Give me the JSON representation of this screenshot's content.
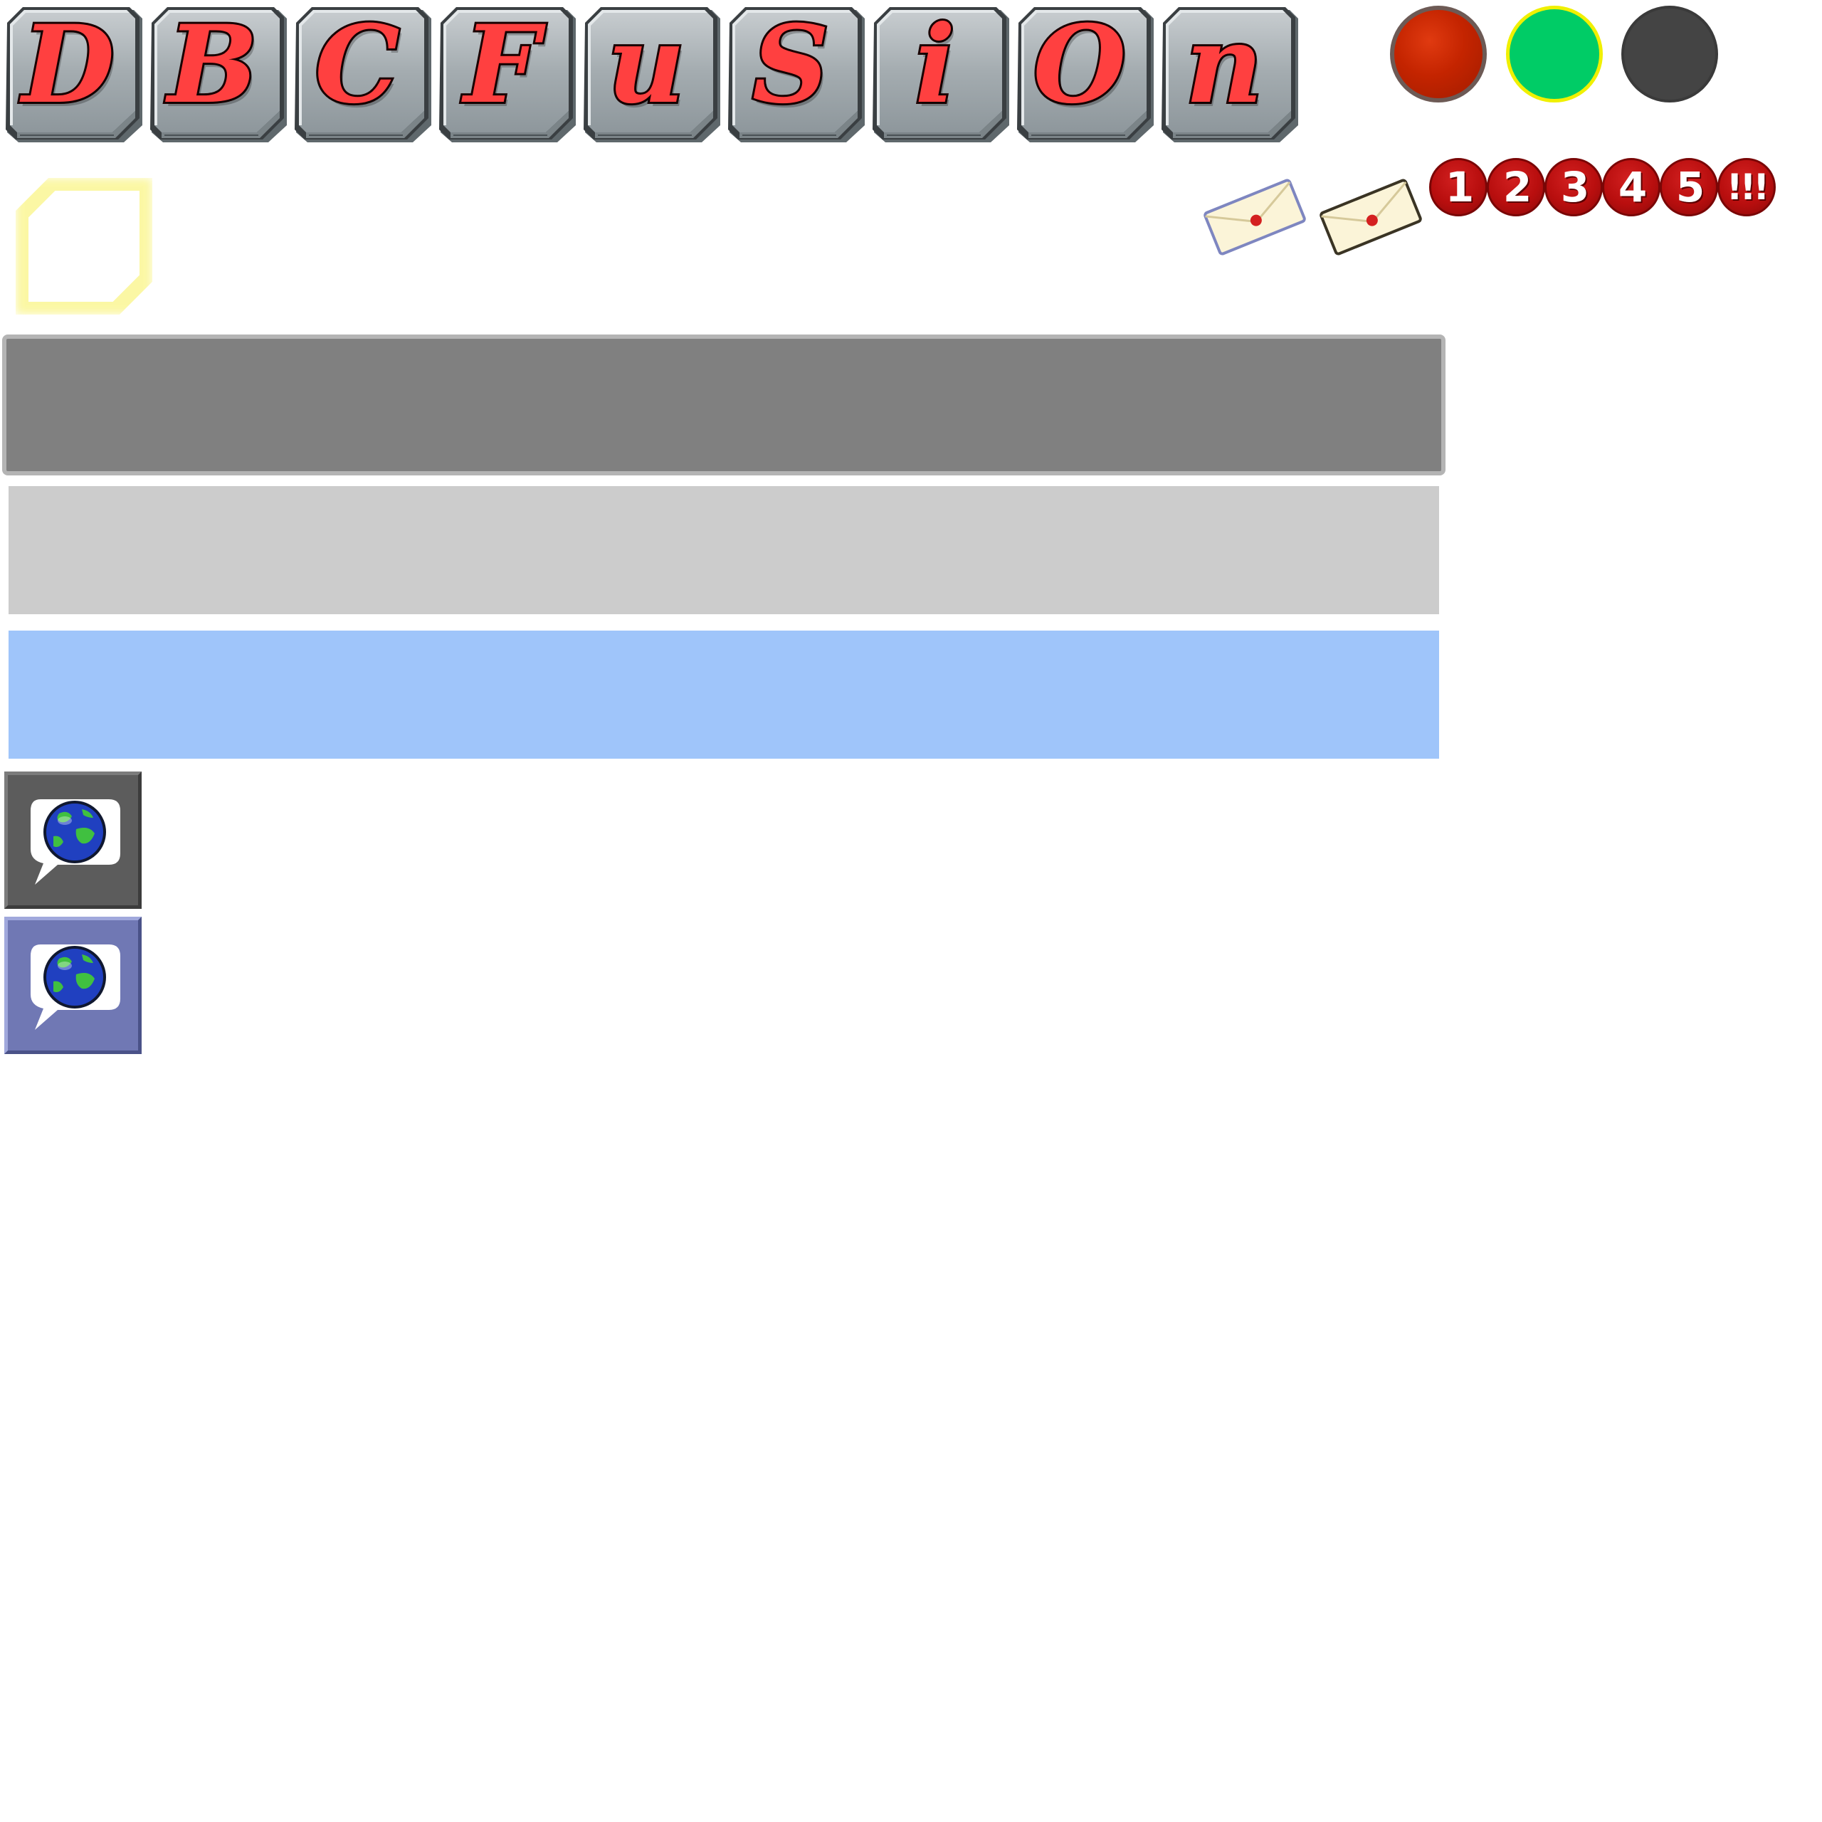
{
  "header": {
    "title_letters": [
      "D",
      "B",
      "C",
      "F",
      "u",
      "S",
      "i",
      "O",
      "n"
    ]
  },
  "status_lights": [
    {
      "name": "red",
      "color": "#c42400"
    },
    {
      "name": "green",
      "color": "#00cc66"
    },
    {
      "name": "dark",
      "color": "#444444"
    }
  ],
  "notifications": {
    "badges": [
      "1",
      "2",
      "3",
      "4",
      "5",
      "!!!"
    ],
    "badge_color": "#b80e0e"
  },
  "icons": {
    "mail": "envelope-icon",
    "chat": "chat-globe-icon"
  },
  "colors": {
    "tile_letter": "#ff4040",
    "tile_face": "#a8b0b4",
    "bar_dark": "#808080",
    "bar_light": "#cccccc",
    "bar_blue": "#9fc5fa",
    "chat_gray": "#5c5c5c",
    "chat_blue": "#7078b4",
    "avatar_glow": "#f8f040"
  }
}
